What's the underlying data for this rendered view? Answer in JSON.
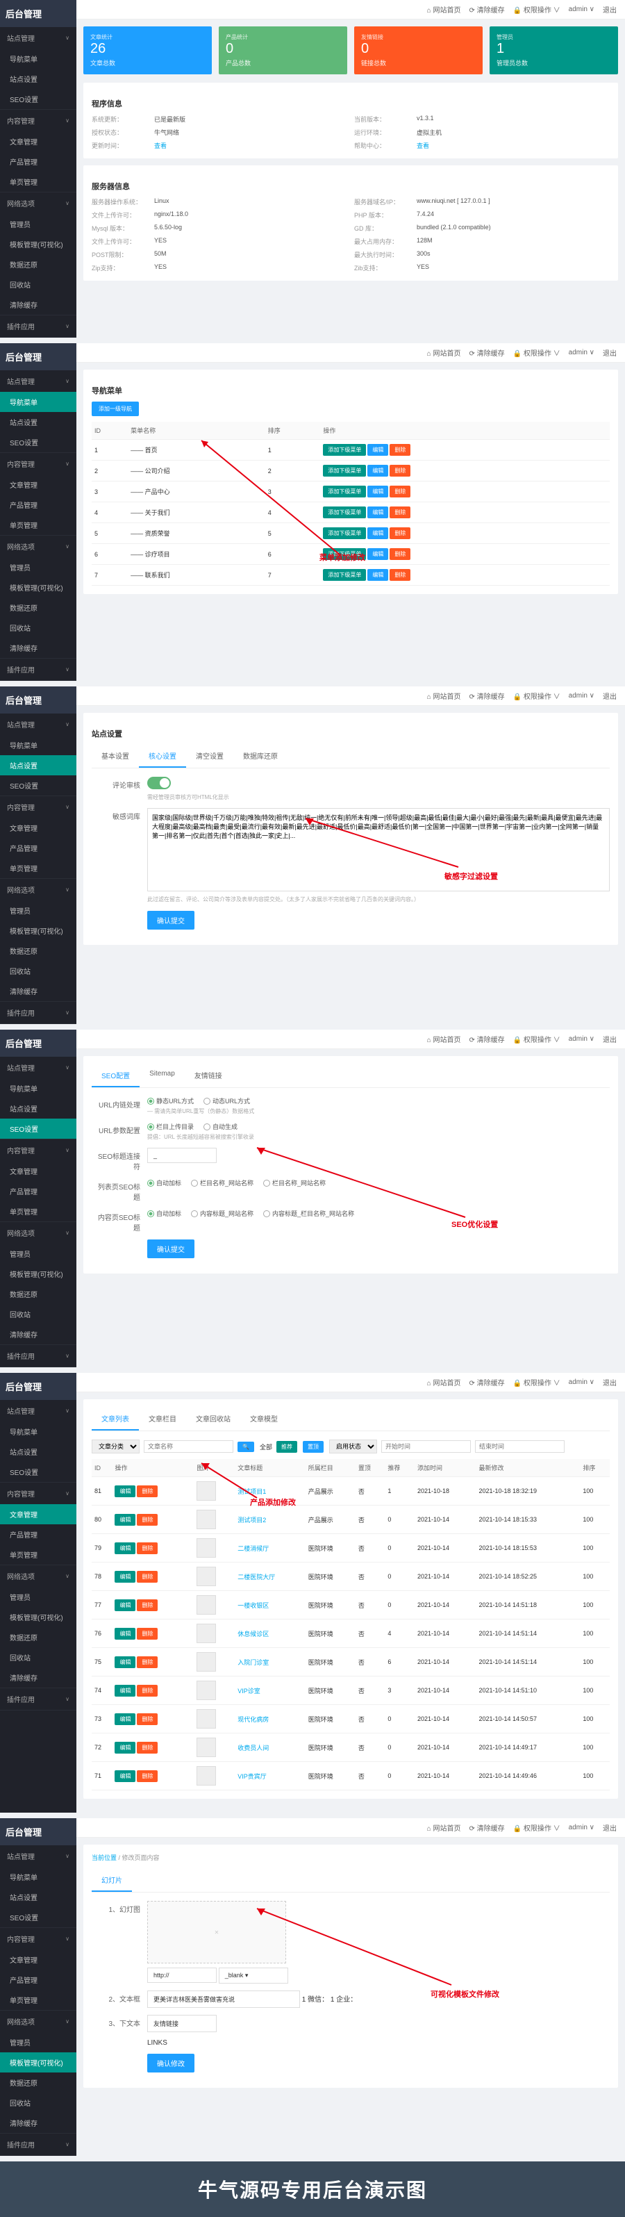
{
  "common": {
    "logo": "后台管理",
    "topbar": {
      "home": "⌂ 网站首页",
      "clear": "⟳ 清除缓存",
      "lock": "🔒 权限操作 ∨",
      "user": "admin ∨",
      "logout": "退出"
    },
    "side_groups": [
      {
        "title": "站点管理",
        "items": [
          "导航菜单",
          "站点设置",
          "SEO设置"
        ]
      },
      {
        "title": "内容管理",
        "items": [
          "文章管理",
          "产品管理",
          "单页管理"
        ]
      },
      {
        "title": "网络选项",
        "items": [
          "管理员",
          "模板管理(可视化)",
          "数据还原",
          "回收站",
          "清除缓存"
        ]
      },
      {
        "title": "插件应用",
        "items": []
      }
    ]
  },
  "p1": {
    "stats": [
      {
        "num": "26",
        "lbl": "文章总数",
        "sub": "文章统计",
        "cls": "blue"
      },
      {
        "num": "0",
        "lbl": "产品总数",
        "sub": "产品统计",
        "cls": "green"
      },
      {
        "num": "0",
        "lbl": "链接总数",
        "sub": "友情链接",
        "cls": "orange"
      },
      {
        "num": "1",
        "lbl": "管理员总数",
        "sub": "管理员",
        "cls": "teal"
      }
    ],
    "program_title": "程序信息",
    "program": [
      [
        "系统更新：",
        "已是最新版",
        "当前版本：",
        "v1.3.1"
      ],
      [
        "授权状态：",
        "牛气网络",
        "运行环境：",
        "虚拟主机"
      ],
      [
        "更新时间：",
        "查看",
        "帮助中心：",
        "查看"
      ]
    ],
    "server_title": "服务器信息",
    "server": [
      [
        "服务器操作系统：",
        "Linux",
        "服务器域名/IP：",
        "www.niuqi.net [ 127.0.0.1 ]"
      ],
      [
        "文件上传许可：",
        "nginx/1.18.0",
        "PHP 版本：",
        "7.4.24"
      ],
      [
        "Mysql 版本：",
        "5.6.50-log",
        "GD 库：",
        "bundled (2.1.0 compatible)"
      ],
      [
        "文件上传许可：",
        "YES",
        "最大占用内存：",
        "128M"
      ],
      [
        "POST限制：",
        "50M",
        "最大执行时间：",
        "300s"
      ],
      [
        "Zip支持：",
        "YES",
        "Zib支持：",
        "YES"
      ]
    ]
  },
  "p2": {
    "title": "导航菜单",
    "add_btn": "添加一级导航",
    "cols": [
      "ID",
      "菜单名称",
      "排序",
      "操作"
    ],
    "rows": [
      {
        "id": "1",
        "name": "—— 首页",
        "sort": "1"
      },
      {
        "id": "2",
        "name": "—— 公司介绍",
        "sort": "2"
      },
      {
        "id": "3",
        "name": "—— 产品中心",
        "sort": "3"
      },
      {
        "id": "4",
        "name": "—— 关于我们",
        "sort": "4"
      },
      {
        "id": "5",
        "name": "—— 资质荣誉",
        "sort": "5"
      },
      {
        "id": "6",
        "name": "—— 诊疗项目",
        "sort": "6"
      },
      {
        "id": "7",
        "name": "—— 联系我们",
        "sort": "7"
      }
    ],
    "op_labels": {
      "sub": "添加下级菜单",
      "edit": "编辑",
      "del": "删除"
    },
    "annot": "菜单添加修改"
  },
  "p3": {
    "title": "站点设置",
    "tabs": [
      "基本设置",
      "核心设置",
      "清空设置",
      "数据库还原"
    ],
    "label_filter": "评论审核",
    "hint_filter": "需经管理员审核方可HTML化显示",
    "label_words": "敏感词库",
    "words": "国家级|国际级|世界级|千万级|万能|唯独|特效|祖传|无敌|纯一|绝无仅有|前所未有|唯一|领导|超级|最高|最低|最佳|最大|最小|最好|最强|最先|最新|最具|最便宜|最先进|最大程度|最高级|最高档|最贵|最受|最流行|最有效|最新|最先进|最舒适|最低价|最高|最舒适|最低价|第一|全国第一|中国第一|世界第一|宇宙第一|业内第一|全网第一|销量第一|排名第一|仅此|首先|首个|首选|独此一家|史上|...",
    "tip": "此过滤在留言、评论、公司简介等涉及表单内容提交处。（太多了人家展示不完就省略了几百条的关键词内容。）",
    "save": "确认提交",
    "annot": "敏感字过滤设置"
  },
  "p4": {
    "tabs": [
      "SEO配置",
      "Sitemap",
      "友情链接"
    ],
    "r_url": {
      "label": "URL内链处理",
      "opts": [
        "静态URL方式",
        "动态URL方式"
      ],
      "hint": "— 需请先简单URL重写（伪静态）数据格式"
    },
    "r_param": {
      "label": "URL参数配置",
      "opts": [
        "栏目上传目录",
        "自动生成"
      ],
      "hint": "提倡：URL 长度越短越容易被搜索引擎收录"
    },
    "r_title": {
      "label": "SEO标题连接符",
      "val": "_"
    },
    "r_list": {
      "label": "列表页SEO标题",
      "opts": [
        "自动加标",
        "栏目名称_网站名称",
        "栏目名称_网站名称"
      ]
    },
    "r_cont": {
      "label": "内容页SEO标题",
      "opts": [
        "自动加标",
        "内容标题_网站名称",
        "内容标题_栏目名称_网站名称"
      ]
    },
    "save": "确认提交",
    "annot": "SEO优化设置"
  },
  "p5": {
    "tabs": [
      "文章列表",
      "文章栏目",
      "文章回收站",
      "文章模型"
    ],
    "filters": {
      "cat": "文章分类",
      "name": "文章名称",
      "search": "搜索",
      "all": "全部",
      "rec": "推荐",
      "top": "置顶",
      "status": "启用状态",
      "start": "开始时间",
      "end": "结束时间"
    },
    "cols": [
      "ID",
      "操作",
      "图片",
      "文章标题",
      "所属栏目",
      "置顶",
      "推荐",
      "添加时间",
      "最新修改",
      "排序"
    ],
    "rows": [
      {
        "id": "81",
        "title": "测试项目1",
        "cat": "产品展示",
        "top": "否",
        "rec": "1",
        "add": "2021-10-18",
        "mod": "2021-10-18 18:32:19",
        "sort": "100"
      },
      {
        "id": "80",
        "title": "测试项目2",
        "cat": "产品展示",
        "top": "否",
        "rec": "0",
        "add": "2021-10-14",
        "mod": "2021-10-14 18:15:33",
        "sort": "100"
      },
      {
        "id": "79",
        "title": "二楼消候厅",
        "cat": "医院环境",
        "top": "否",
        "rec": "0",
        "add": "2021-10-14",
        "mod": "2021-10-14 18:15:53",
        "sort": "100"
      },
      {
        "id": "78",
        "title": "二楼医院大厅",
        "cat": "医院环境",
        "top": "否",
        "rec": "0",
        "add": "2021-10-14",
        "mod": "2021-10-14 18:52:25",
        "sort": "100"
      },
      {
        "id": "77",
        "title": "一楼收银区",
        "cat": "医院环境",
        "top": "否",
        "rec": "0",
        "add": "2021-10-14",
        "mod": "2021-10-14 14:51:18",
        "sort": "100"
      },
      {
        "id": "76",
        "title": "休息候诊区",
        "cat": "医院环境",
        "top": "否",
        "rec": "4",
        "add": "2021-10-14",
        "mod": "2021-10-14 14:51:14",
        "sort": "100"
      },
      {
        "id": "75",
        "title": "入院门诊室",
        "cat": "医院环境",
        "top": "否",
        "rec": "6",
        "add": "2021-10-14",
        "mod": "2021-10-14 14:51:14",
        "sort": "100"
      },
      {
        "id": "74",
        "title": "VIP诊室",
        "cat": "医院环境",
        "top": "否",
        "rec": "3",
        "add": "2021-10-14",
        "mod": "2021-10-14 14:51:10",
        "sort": "100"
      },
      {
        "id": "73",
        "title": "现代化病房",
        "cat": "医院环境",
        "top": "否",
        "rec": "0",
        "add": "2021-10-14",
        "mod": "2021-10-14 14:50:57",
        "sort": "100"
      },
      {
        "id": "72",
        "title": "收费员人间",
        "cat": "医院环境",
        "top": "否",
        "rec": "0",
        "add": "2021-10-14",
        "mod": "2021-10-14 14:49:17",
        "sort": "100"
      },
      {
        "id": "71",
        "title": "VIP贵宾厅",
        "cat": "医院环境",
        "top": "否",
        "rec": "0",
        "add": "2021-10-14",
        "mod": "2021-10-14 14:49:46",
        "sort": "100"
      }
    ],
    "op": {
      "edit": "编辑",
      "del": "删除"
    },
    "annot": "产品添加修改"
  },
  "p6": {
    "crumb_home": "当前位置",
    "crumb": "修改页面内容",
    "tabs": [
      "幻灯片"
    ],
    "field1": {
      "label": "1、幻灯图",
      "placeholder": "http://",
      "target": "_blank"
    },
    "field2": {
      "label": "2、文本框",
      "placeholder": "更美详吉林医美吾雾做害充说",
      "lbls": [
        "1 微信：",
        "1 企业："
      ]
    },
    "field3": {
      "label": "3、下文本",
      "val": "友情链接"
    },
    "field4": {
      "label": "LINKS"
    },
    "save": "确认修改",
    "annot": "可视化模板文件修改"
  },
  "footer": "牛气源码专用后台演示图"
}
